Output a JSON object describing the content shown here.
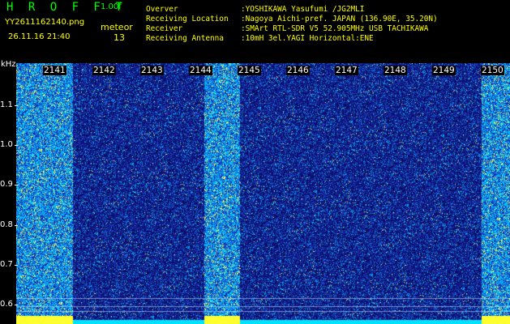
{
  "header": {
    "app_title": "H R O F F T",
    "app_version": "1.00f",
    "filename": "YY2611162140.png",
    "meteor_label": "meteor",
    "datetime": "26.11.16 21:40",
    "meteor_count": "13",
    "info_lines": [
      {
        "key": "Overver",
        "value": ":YOSHIKAWA Yasufumi /JG2MLI"
      },
      {
        "key": "Receiving Location",
        "value": ":Nagoya Aichi-pref. JAPAN (136.90E, 35.20N)"
      },
      {
        "key": "Receiver",
        "value": ":SMArt RTL-SDR V5 52.905MHz USB TACHIKAWA"
      },
      {
        "key": "Receiving Antenna",
        "value": ":10mH 3el.YAGI Horizontal:ENE"
      }
    ]
  },
  "axes": {
    "y_unit": "kHz",
    "y_ticks": [
      "1.1",
      "1.0",
      "0.9",
      "0.8",
      "0.7",
      "0.6"
    ],
    "x_labels": [
      "2141",
      "2142",
      "2143",
      "2144",
      "2145",
      "2146",
      "2147",
      "2148",
      "2149",
      "2150"
    ]
  },
  "colors": {
    "noise_deep": "#10107a",
    "noise_cyan": "#00c8ff",
    "noise_yellow": "#ffff40",
    "text_yellow": "#ffff00",
    "text_green": "#00ff00"
  },
  "spectrogram": {
    "bright_minute_bands": [
      "2141",
      "2145",
      "2150"
    ]
  }
}
